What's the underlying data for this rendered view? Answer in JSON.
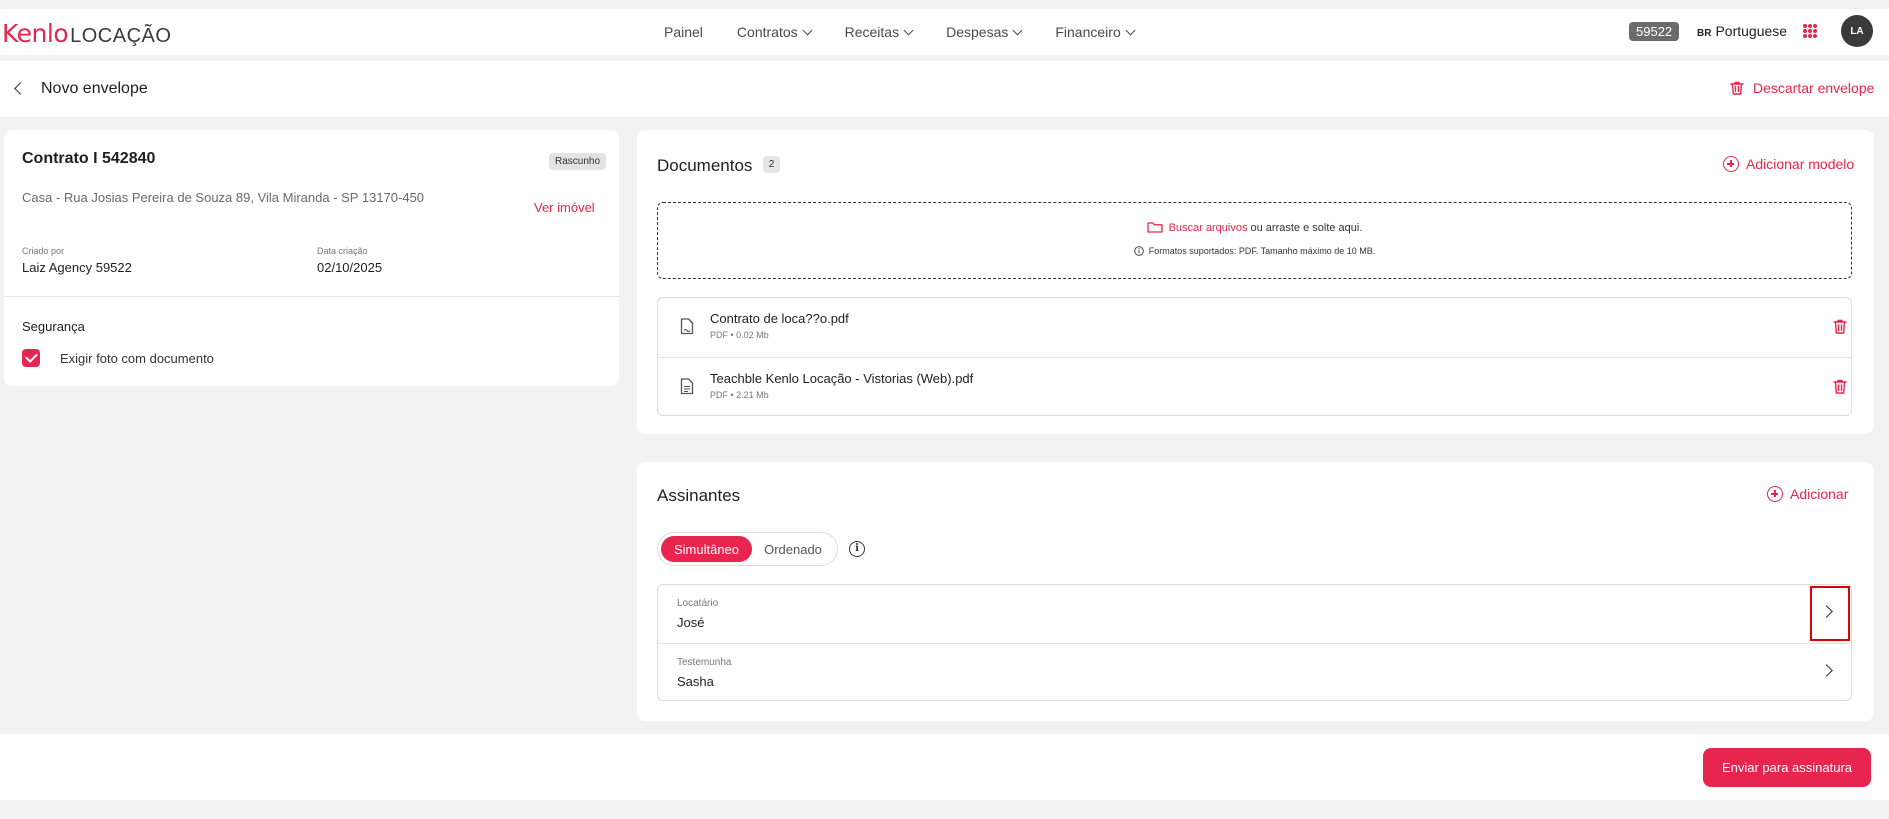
{
  "header": {
    "logo_brand": "Kenlo",
    "logo_sub": "LOCAÇÃO",
    "menu": [
      {
        "label": "Painel"
      },
      {
        "label": "Contratos"
      },
      {
        "label": "Receitas"
      },
      {
        "label": "Despesas"
      },
      {
        "label": "Financeiro"
      }
    ],
    "agency_id": "59522",
    "language_flag": "BR",
    "language": "Portuguese",
    "avatar_initials": "LA"
  },
  "page": {
    "title": "Novo envelope",
    "discard_label": "Descartar envelope"
  },
  "contract": {
    "title": "Contrato I 542840",
    "status": "Rascunho",
    "address": "Casa - Rua Josias Pereira de Souza 89, Vila Miranda - SP 13170-450",
    "see_property": "Ver imóvel",
    "created_by_label": "Criado por",
    "created_by": "Laiz Agency 59522",
    "created_date_label": "Data criação",
    "created_date": "02/10/2025",
    "security_title": "Segurança",
    "require_photo_label": "Exigir foto com documento"
  },
  "documents": {
    "title": "Documentos",
    "count": "2",
    "add_model": "Adicionar modelo",
    "dropzone_link": "Buscar arquivos",
    "dropzone_text": " ou arraste e solte aqui.",
    "dropzone_hint": "Formatos suportados: PDF. Tamanho máximo de 10 MB.",
    "files": [
      {
        "name": "Contrato de loca??o.pdf",
        "meta": "PDF • 0.02 Mb"
      },
      {
        "name": "Teachble Kenlo Locação - Vistorias (Web).pdf",
        "meta": "PDF • 2.21 Mb"
      }
    ]
  },
  "signers": {
    "title": "Assinantes",
    "add_label": "Adicionar",
    "mode_simultaneous": "Simultâneo",
    "mode_ordered": "Ordenado",
    "list": [
      {
        "role": "Locatário",
        "name": "José"
      },
      {
        "role": "Testemunha",
        "name": "Sasha"
      }
    ]
  },
  "footer": {
    "send_label": "Enviar para assinatura"
  },
  "colors": {
    "accent": "#e8254e",
    "background": "#f2f2f2",
    "highlight": "#e00000"
  }
}
